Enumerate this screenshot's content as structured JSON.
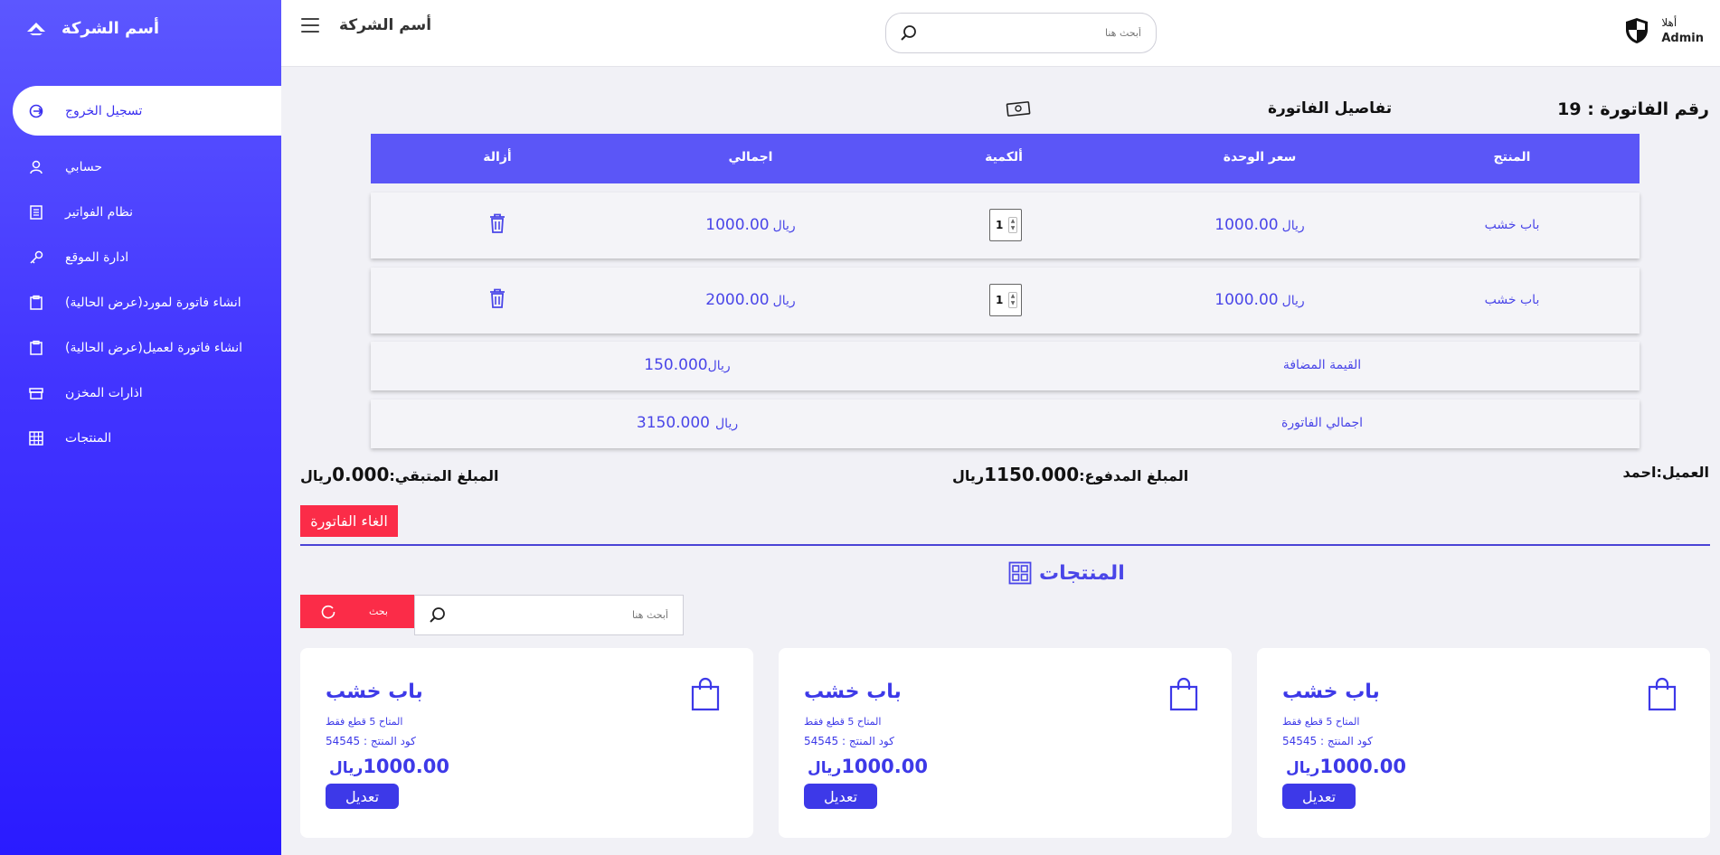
{
  "sidebar": {
    "brand": "أسم الشركة",
    "items": [
      {
        "label": "تسجيل الخروج",
        "icon": "logout-icon"
      },
      {
        "label": "حسابي",
        "icon": "user-icon"
      },
      {
        "label": "نظام الفواتير",
        "icon": "receipt-icon"
      },
      {
        "label": "ادارة الموقع",
        "icon": "key-icon"
      },
      {
        "label": "انشاء فاتورة لمورد(عرض الحالية)",
        "icon": "clipboard-icon"
      },
      {
        "label": "انشاء فاتورة لعميل(عرض الحالية)",
        "icon": "clipboard-icon"
      },
      {
        "label": "اذارات المخزن",
        "icon": "archive-icon"
      },
      {
        "label": "المنتجات",
        "icon": "grid-icon"
      }
    ]
  },
  "topbar": {
    "title": "أسم الشركة",
    "search_placeholder": "أبحث هنا",
    "greeting": "أهلا",
    "user_name": "Admin"
  },
  "invoice": {
    "number_label": "رقم الفاتورة : 19",
    "title": "تفاصيل الفاتورة",
    "columns": [
      "المنتج",
      "سعر الوحدة",
      "ألكمية",
      "اجمالي",
      "أزالة"
    ],
    "currency": "ريال",
    "rows": [
      {
        "product": "باب خشب",
        "unit_price": "1000.00",
        "qty": "1",
        "total": "1000.00"
      },
      {
        "product": "باب خشب",
        "unit_price": "1000.00",
        "qty": "1",
        "total": "2000.00"
      }
    ],
    "vat_label": "القيمة المضافة",
    "vat_value": "150.000",
    "grand_label": "اجمالي الفاتورة",
    "grand_value": "3150.000",
    "customer_label": "العميل:",
    "customer_name": "احمد",
    "paid_label": "المبلغ المدفوع:",
    "paid_value": "1150.000",
    "remain_label": "المبلغ المتبقي:",
    "remain_value": "0.000",
    "cancel_label": "الغاء الفاتورة"
  },
  "products": {
    "title": "المنتجات",
    "search_button": "بحث",
    "search_placeholder": "أبحث هنا",
    "cards": [
      {
        "name": "باب خشب",
        "stock": "المتاح 5 قطع فقط",
        "code": "كود المنتج : 54545",
        "price": "1000.00",
        "currency": "ريال",
        "edit": "تعديل"
      },
      {
        "name": "باب خشب",
        "stock": "المتاح 5 قطع فقط",
        "code": "كود المنتج : 54545",
        "price": "1000.00",
        "currency": "ريال",
        "edit": "تعديل"
      },
      {
        "name": "باب خشب",
        "stock": "المتاح 5 قطع فقط",
        "code": "كود المنتج : 54545",
        "price": "1000.00",
        "currency": "ريال",
        "edit": "تعديل"
      }
    ]
  },
  "colors": {
    "accent": "#5b56f7",
    "danger": "#fb2c48",
    "text_accent": "#3d39e8"
  }
}
